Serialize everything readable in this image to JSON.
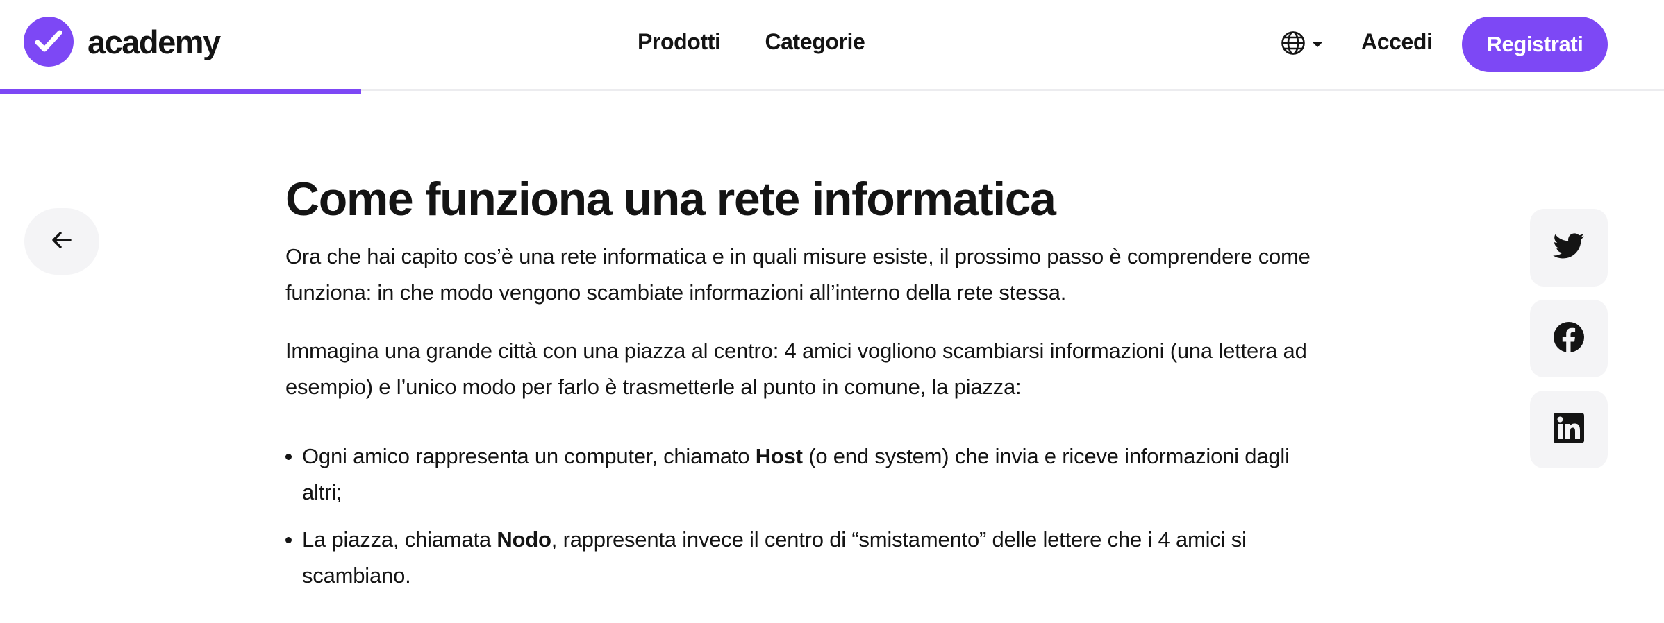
{
  "header": {
    "logo_text": "academy",
    "nav": [
      "Prodotti",
      "Categorie"
    ],
    "language_icon": "globe-icon",
    "login_label": "Accedi",
    "register_label": "Registrati",
    "reading_progress_fraction": 0.217
  },
  "side": {
    "back_icon": "arrow-left-icon",
    "share_icons": [
      "twitter-icon",
      "facebook-icon",
      "linkedin-icon"
    ]
  },
  "article": {
    "title": "Come funziona una rete informatica",
    "paragraph_1": "Ora che hai capito cos’è una rete informatica e in quali misure esiste, il prossimo passo è comprendere come funziona: in che modo vengono scambiate informazioni all’interno della rete stessa.",
    "paragraph_2": "Immagina una grande città con una piazza al centro: 4 amici vogliono scambiarsi informazioni (una lettera ad esempio) e l’unico modo per farlo è trasmetterle al punto in comune, la piazza:",
    "list": [
      {
        "before": "Ogni amico rappresenta un computer, chiamato ",
        "bold": "Host",
        "after": " (o end system) che invia e riceve informazioni dagli altri;"
      },
      {
        "before": "La piazza, chiamata ",
        "bold": "Nodo",
        "after": ", rappresenta invece il centro di “smistamento” delle lettere che i 4 amici si scambiano."
      }
    ]
  },
  "colors": {
    "accent": "#7d48f5",
    "text": "#141414",
    "button_bg": "#f4f4f6",
    "divider": "#ececef"
  }
}
